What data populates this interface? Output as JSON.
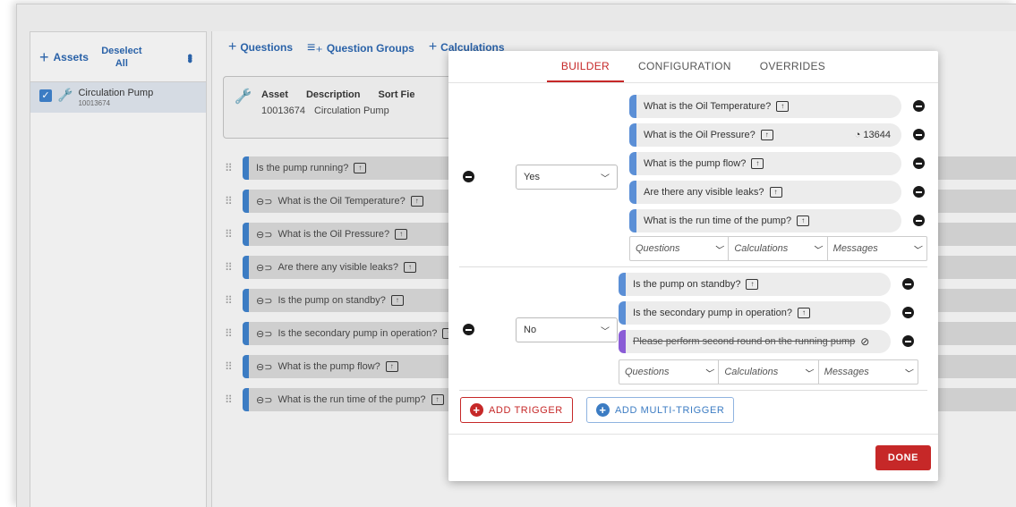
{
  "left_panel": {
    "add_assets_label": "Assets",
    "deselect_label": "Deselect All",
    "asset": {
      "name": "Circulation Pump",
      "id": "10013674"
    }
  },
  "toolbar": {
    "questions_label": "Questions",
    "question_groups_label": "Question Groups",
    "calculations_label": "Calculations"
  },
  "asset_card": {
    "headers": [
      "Asset",
      "Description",
      "Sort Fie"
    ],
    "asset_value": "10013674",
    "description_value": "Circulation Pump"
  },
  "question_list": [
    {
      "text": "Is the pump running?",
      "linked": false
    },
    {
      "text": "What is the Oil Temperature?",
      "linked": true
    },
    {
      "text": "What is the Oil Pressure?",
      "linked": true
    },
    {
      "text": "Are there any visible leaks?",
      "linked": true
    },
    {
      "text": "Is the pump on standby?",
      "linked": true
    },
    {
      "text": "Is the secondary pump in operation?",
      "linked": true
    },
    {
      "text": "What is the pump flow?",
      "linked": true
    },
    {
      "text": "What is the run time of the pump?",
      "linked": true
    }
  ],
  "modal": {
    "tabs": [
      "BUILDER",
      "CONFIGURATION",
      "OVERRIDES"
    ],
    "active_tab": "BUILDER",
    "triggers": [
      {
        "value": "Yes",
        "items": [
          {
            "text": "What is the Oil Temperature?",
            "color": "#5b8fd6",
            "badge": ""
          },
          {
            "text": "What is the Oil Pressure?",
            "color": "#5b8fd6",
            "badge": "13644"
          },
          {
            "text": "What is the pump flow?",
            "color": "#5b8fd6",
            "badge": ""
          },
          {
            "text": "Are there any visible leaks?",
            "color": "#5b8fd6",
            "badge": ""
          },
          {
            "text": "What is the run time of the pump?",
            "color": "#5b8fd6",
            "badge": ""
          }
        ]
      },
      {
        "value": "No",
        "items": [
          {
            "text": "Is the pump on standby?",
            "color": "#5b8fd6",
            "badge": ""
          },
          {
            "text": "Is the secondary pump in operation?",
            "color": "#5b8fd6",
            "badge": ""
          },
          {
            "text": "Please perform second round on the running pump",
            "color": "#8a5cd6",
            "badge": ""
          }
        ]
      }
    ],
    "dropdowns": {
      "questions": "Questions",
      "calculations": "Calculations",
      "messages": "Messages"
    },
    "add_trigger_label": "ADD TRIGGER",
    "add_multi_trigger_label": "ADD MULTI-TRIGGER",
    "done_label": "DONE"
  },
  "colors": {
    "accent_red": "#c62828",
    "primary_blue": "#2a62a8",
    "message_purple": "#8a5cd6"
  }
}
